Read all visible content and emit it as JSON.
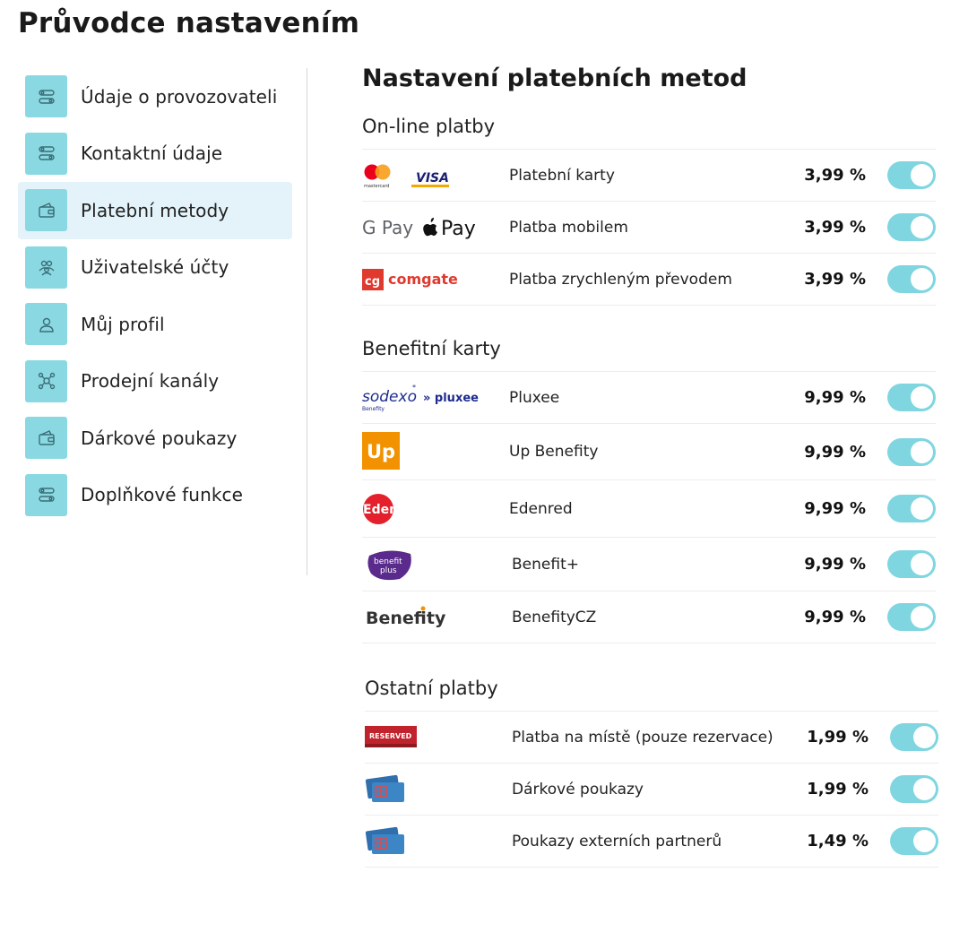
{
  "page": {
    "title": "Průvodce nastavením"
  },
  "sidebar": {
    "items": [
      {
        "label": "Údaje o provozovateli",
        "icon": "sliders-icon",
        "active": false
      },
      {
        "label": "Kontaktní údaje",
        "icon": "sliders-icon",
        "active": false
      },
      {
        "label": "Platební metody",
        "icon": "wallet-icon",
        "active": true
      },
      {
        "label": "Uživatelské účty",
        "icon": "users-icon",
        "active": false
      },
      {
        "label": "Můj profil",
        "icon": "user-icon",
        "active": false
      },
      {
        "label": "Prodejní kanály",
        "icon": "network-icon",
        "active": false
      },
      {
        "label": "Dárkové poukazy",
        "icon": "wallet-icon",
        "active": false
      },
      {
        "label": "Doplňkové funkce",
        "icon": "sliders-icon",
        "active": false
      }
    ]
  },
  "main": {
    "title": "Nastavení platebních metod",
    "sections": [
      {
        "title": "On-line platby",
        "rows": [
          {
            "logo": "mastercard-visa-logo",
            "logo_text": [
              "mastercard",
              "VISA"
            ],
            "name": "Platební karty",
            "fee": "3,99 %",
            "enabled": true
          },
          {
            "logo": "gpay-applepay-logo",
            "logo_text": [
              "G Pay",
              "Pay"
            ],
            "name": "Platba mobilem",
            "fee": "3,99 %",
            "enabled": true
          },
          {
            "logo": "comgate-logo",
            "logo_text": [
              "cg",
              "comgate"
            ],
            "name": "Platba zrychleným převodem",
            "fee": "3,99 %",
            "enabled": true
          }
        ]
      },
      {
        "title": "Benefitní karty",
        "rows": [
          {
            "logo": "sodexo-pluxee-logo",
            "logo_text": [
              "sodexo",
              "» pluxee",
              "Benefity"
            ],
            "name": "Pluxee",
            "fee": "9,99 %",
            "enabled": true
          },
          {
            "logo": "up-logo",
            "logo_text": [
              "Up"
            ],
            "name": "Up Benefity",
            "fee": "9,99 %",
            "enabled": true
          },
          {
            "logo": "edenred-logo",
            "logo_text": [
              "Edenred"
            ],
            "name": "Edenred",
            "fee": "9,99 %",
            "enabled": true
          },
          {
            "logo": "benefit-plus-logo",
            "logo_text": [
              "benefit",
              "plus"
            ],
            "name": "Benefit+",
            "fee": "9,99 %",
            "enabled": true
          },
          {
            "logo": "benefity-logo",
            "logo_text": [
              "Benefity"
            ],
            "name": "BenefityCZ",
            "fee": "9,99 %",
            "enabled": true
          }
        ]
      },
      {
        "title": "Ostatní platby",
        "rows": [
          {
            "logo": "reserved-sign-logo",
            "logo_text": [
              "RESERVED"
            ],
            "name": "Platba na místě (pouze rezervace)",
            "fee": "1,99 %",
            "enabled": true
          },
          {
            "logo": "gift-voucher-icon",
            "name": "Dárkové poukazy",
            "fee": "1,99 %",
            "enabled": true
          },
          {
            "logo": "gift-voucher-icon",
            "name": "Poukazy externích partnerů",
            "fee": "1,49 %",
            "enabled": true
          }
        ]
      }
    ]
  },
  "colors": {
    "accent": "#8ad9e2",
    "toggle_on": "#7fd6e0",
    "active_bg": "#e3f3f9"
  }
}
